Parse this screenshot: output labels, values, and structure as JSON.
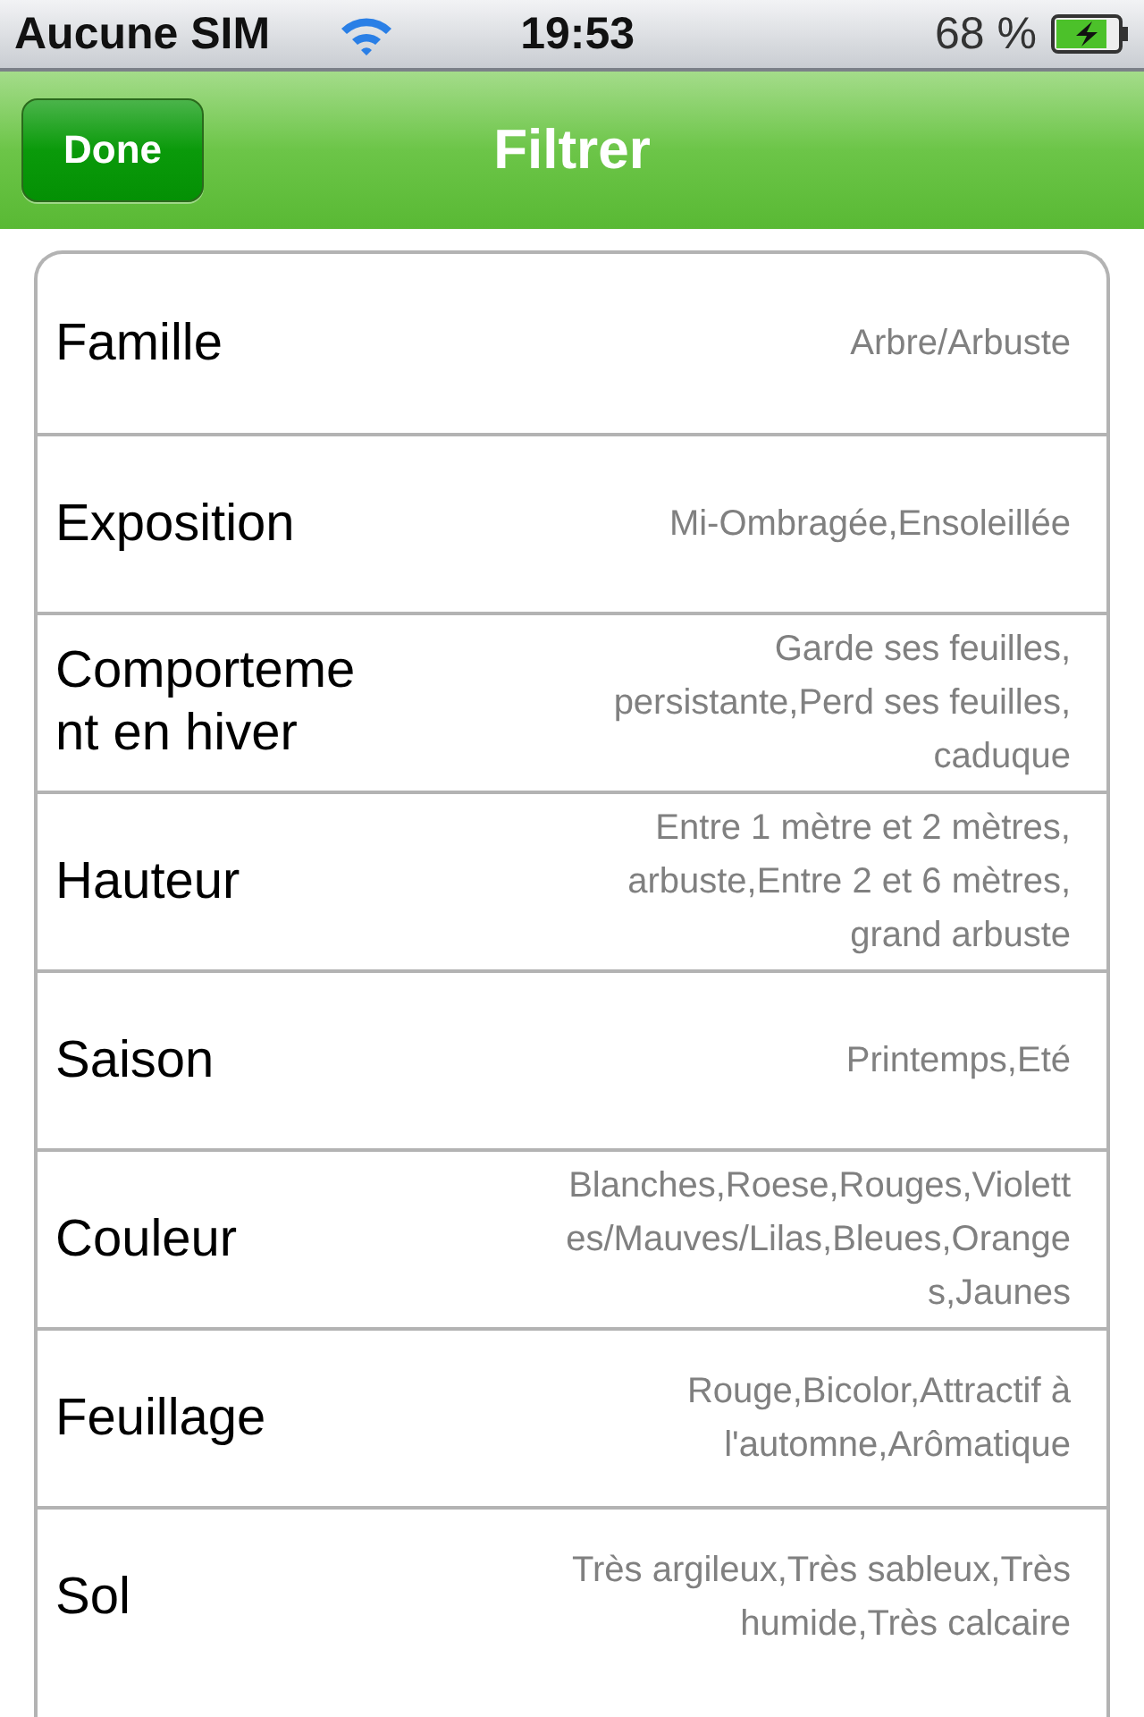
{
  "status_bar": {
    "carrier": "Aucune SIM",
    "time": "19:53",
    "battery": "68 %"
  },
  "nav_bar": {
    "button": "Done",
    "title": "Filtrer"
  },
  "rows": [
    {
      "label": [
        "Famille"
      ],
      "value": [
        "Arbre/Arbuste"
      ]
    },
    {
      "label": [
        "Exposition"
      ],
      "value": [
        "Mi-Ombragée,Ensoleillée"
      ]
    },
    {
      "label": [
        "Comporteme",
        "nt en hiver"
      ],
      "value": [
        "Garde ses feuilles,",
        "persistante,Perd ses feuilles,",
        "caduque"
      ]
    },
    {
      "label": [
        "Hauteur"
      ],
      "value": [
        "Entre 1 mètre et 2 mètres,",
        "arbuste,Entre 2 et 6 mètres,",
        "grand arbuste"
      ]
    },
    {
      "label": [
        "Saison"
      ],
      "value": [
        "Printemps,Eté"
      ]
    },
    {
      "label": [
        "Couleur"
      ],
      "value": [
        "Blanches,Roese,Rouges,Violett",
        "es/Mauves/Lilas,Bleues,Orange",
        "s,Jaunes"
      ]
    },
    {
      "label": [
        "Feuillage"
      ],
      "value": [
        "Rouge,Bicolor,Attractif à",
        "l'automne,Arômatique"
      ]
    },
    {
      "label": [
        "Sol"
      ],
      "value": [
        "Très argileux,Très sableux,Très",
        "humide,Très calcaire"
      ]
    }
  ]
}
